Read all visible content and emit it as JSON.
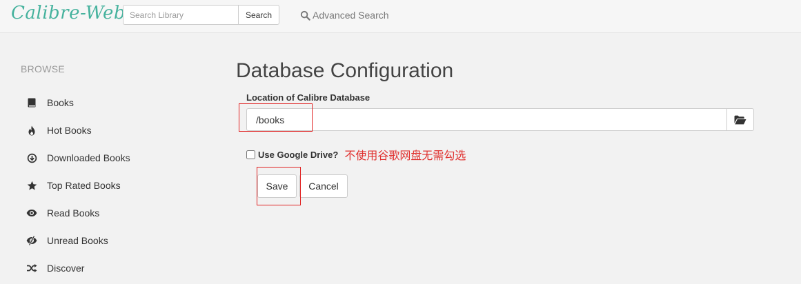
{
  "header": {
    "brand": "Calibre-Web",
    "search": {
      "placeholder": "Search Library",
      "value": ""
    },
    "search_button": "Search",
    "advanced_search": "Advanced Search"
  },
  "sidebar": {
    "title": "BROWSE",
    "items": [
      {
        "label": "Books",
        "icon": "book-icon"
      },
      {
        "label": "Hot Books",
        "icon": "fire-icon"
      },
      {
        "label": "Downloaded Books",
        "icon": "download-icon"
      },
      {
        "label": "Top Rated Books",
        "icon": "star-icon"
      },
      {
        "label": "Read Books",
        "icon": "eye-icon"
      },
      {
        "label": "Unread Books",
        "icon": "eye-slash-icon"
      },
      {
        "label": "Discover",
        "icon": "shuffle-icon"
      }
    ]
  },
  "main": {
    "title": "Database Configuration",
    "db_location": {
      "label": "Location of Calibre Database",
      "value": "/books",
      "browse_icon": "folder-open-icon"
    },
    "google_drive": {
      "label": "Use Google Drive?",
      "checked": false,
      "annotation": "不使用谷歌网盘无需勾选"
    },
    "buttons": {
      "save": "Save",
      "cancel": "Cancel"
    }
  },
  "colors": {
    "brand": "#45b29d",
    "annotation": "#e0312f",
    "background": "#f2f2f2"
  }
}
